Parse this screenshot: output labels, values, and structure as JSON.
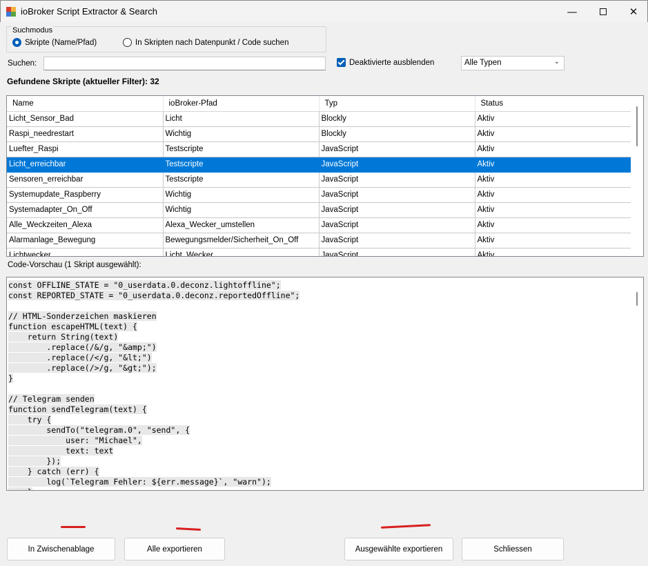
{
  "window": {
    "title": "ioBroker Script Extractor & Search",
    "minimize_glyph": "—",
    "close_glyph": "✕"
  },
  "search_mode": {
    "legend": "Suchmodus",
    "option_name": "Skripte (Name/Pfad)",
    "option_code": "In Skripten nach Datenpunkt / Code suchen",
    "selected": "option_name"
  },
  "search": {
    "label": "Suchen:",
    "value": ""
  },
  "hide_disabled": {
    "label": "Deaktivierte ausblenden",
    "checked": true
  },
  "type_filter": {
    "selected": "Alle Typen",
    "chevron": "⌄"
  },
  "result_count_label": "Gefundene Skripte (aktueller Filter): 32",
  "grid": {
    "columns": [
      "Name",
      "ioBroker-Pfad",
      "Typ",
      "Status"
    ],
    "rows": [
      [
        "Licht_Sensor_Bad",
        "Licht",
        "Blockly",
        "Aktiv"
      ],
      [
        "Raspi_needrestart",
        "Wichtig",
        "Blockly",
        "Aktiv"
      ],
      [
        "Luefter_Raspi",
        "Testscripte",
        "JavaScript",
        "Aktiv"
      ],
      [
        "Licht_erreichbar",
        "Testscripte",
        "JavaScript",
        "Aktiv"
      ],
      [
        "Sensoren_erreichbar",
        "Testscripte",
        "JavaScript",
        "Aktiv"
      ],
      [
        "Systemupdate_Raspberry",
        "Wichtig",
        "JavaScript",
        "Aktiv"
      ],
      [
        "Systemadapter_On_Off",
        "Wichtig",
        "JavaScript",
        "Aktiv"
      ],
      [
        "Alle_Weckzeiten_Alexa",
        "Alexa_Wecker_umstellen",
        "JavaScript",
        "Aktiv"
      ],
      [
        "Alarmanlage_Bewegung",
        "Bewegungsmelder/Sicherheit_On_Off",
        "JavaScript",
        "Aktiv"
      ],
      [
        "Lichtwecker",
        "Licht_Wecker",
        "JavaScript",
        "Aktiv"
      ]
    ],
    "selected_row": 3
  },
  "code_preview": {
    "label": "Code-Vorschau (1 Skript ausgewählt):",
    "lines": [
      "const OFFLINE_STATE = \"0_userdata.0.deconz.lightoffline\";",
      "const REPORTED_STATE = \"0_userdata.0.deconz.reportedOffline\";",
      "",
      "// HTML-Sonderzeichen maskieren",
      "function escapeHTML(text) {",
      "    return String(text)",
      "        .replace(/&/g, \"&amp;\")",
      "        .replace(/</g, \"&lt;\")",
      "        .replace(/>/g, \"&gt;\");",
      "}",
      "",
      "// Telegram senden",
      "function sendTelegram(text) {",
      "    try {",
      "        sendTo(\"telegram.0\", \"send\", {",
      "            user: \"Michael\",",
      "            text: text",
      "        });",
      "    } catch (err) {",
      "        log(`Telegram Fehler: ${err.message}`, \"warn\");",
      "    }"
    ]
  },
  "buttons": {
    "copy": "In Zwischenablage",
    "export_all": "Alle exportieren",
    "export_selected": "Ausgewählte exportieren",
    "close": "Schliessen"
  },
  "colors": {
    "selection": "#0078d7",
    "accent": "#005fb8",
    "annotation_marks": "#d81f1f"
  }
}
